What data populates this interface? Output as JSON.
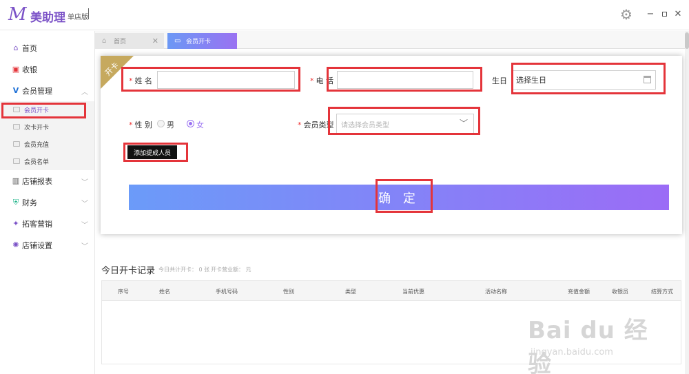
{
  "app": {
    "logo_letter": "M",
    "name": "美助理",
    "edition": "单店版"
  },
  "window": {
    "settings_icon": "gear-icon",
    "minimize": "−",
    "maximize": "▫",
    "close": "✕"
  },
  "sidebar": {
    "home": "首页",
    "cashier": "收银",
    "member_mgmt": "会员管理",
    "member_sub": [
      {
        "label": "会员开卡"
      },
      {
        "label": "次卡开卡"
      },
      {
        "label": "会员充值"
      },
      {
        "label": "会员名单"
      }
    ],
    "store_report": "店铺报表",
    "finance": "财务",
    "marketing": "拓客营销",
    "store_settings": "店铺设置"
  },
  "tabs": {
    "home": "首页",
    "active": "会员开卡",
    "close": "✕"
  },
  "form": {
    "ribbon": "开卡",
    "name_label": "姓 名",
    "phone_label": "电 话",
    "birthday_label": "生日",
    "birthday_placeholder": "选择生日",
    "gender_label": "性 别",
    "gender_male": "男",
    "gender_female": "女",
    "gender_selected": "女",
    "member_type_label": "会员类型",
    "member_type_placeholder": "请选择会员类型",
    "add_staff_button": "添加提成人员",
    "confirm_button": "确 定",
    "required_mark": "*"
  },
  "records": {
    "title": "今日开卡记录",
    "total_cards": "今日共计开卡： 0 张",
    "total_revenue": "开卡营业额：  元",
    "columns": [
      "序号",
      "姓名",
      "手机号码",
      "性别",
      "类型",
      "当前优惠",
      "活动名称",
      "充值金额",
      "收银员",
      "结算方式"
    ]
  },
  "watermark": {
    "main": "Bai du 经验",
    "sub": "jingyan.baidu.com"
  },
  "colors": {
    "brand": "#7b52c7",
    "accent_start": "#6b9bf9",
    "accent_end": "#9b6cf6",
    "highlight": "#e4343a",
    "ribbon": "#c6a95e"
  }
}
